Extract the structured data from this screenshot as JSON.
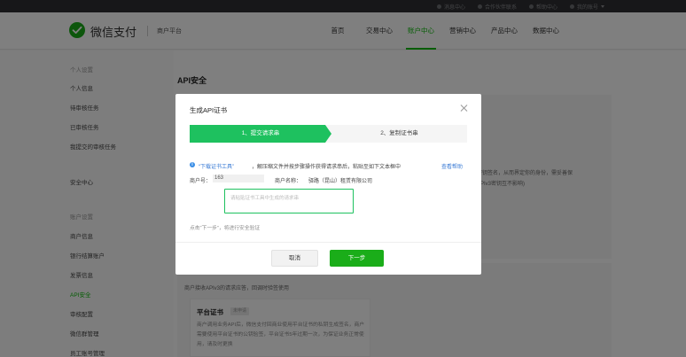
{
  "topbar": {
    "links": [
      {
        "label": "消息中心",
        "icon": "bell-icon"
      },
      {
        "label": "合作伙伴联系",
        "icon": "partner-icon"
      },
      {
        "label": "帮助中心",
        "icon": "help-icon"
      },
      {
        "label": "我的账号",
        "icon": "user-icon"
      }
    ]
  },
  "header": {
    "brand": "微信支付",
    "subbrand": "商户平台",
    "nav": [
      "首页",
      "交易中心",
      "账户中心",
      "营销中心",
      "产品中心",
      "数据中心"
    ],
    "active_nav": "账户中心",
    "accent": "#09bb07"
  },
  "sidebar": {
    "group1": "个人设置",
    "personal": [
      "个人信息",
      "待审核任务",
      "已审核任务",
      "我提交的审核任务"
    ],
    "security": "安全中心",
    "group2": "账户设置",
    "account": [
      "商户信息",
      "银行结算账户",
      "发票信息",
      "API安全",
      "审核配置",
      "微信群管理",
      "员工账号管理"
    ],
    "active_item": "API安全"
  },
  "main": {
    "page_title": "API安全",
    "right_text_1": "密钥签名，从而界定你的身份，需妥善保",
    "right_text_2": "APIv3密钥互不影响)",
    "section_desc": "商户接收APIv3的请求应答，回调时验签使用",
    "cert_card": {
      "title": "平台证书",
      "tag": "未申请",
      "desc": "商户调用业务API后，微信支付回商业使用平台证书的私钥生成签名，商户需要使用平台证书的公钥验签，平台证书5年过期一次，为保证业务正常使用，请及时更换"
    }
  },
  "modal": {
    "title": "生成API证书",
    "steps": [
      "1、提交请求串",
      "2、复制证书串"
    ],
    "info_link": "“下载证书工具”",
    "info_text": "，解压缩文件并按步骤操作获得请求串后，粘贴至如下文本框中",
    "help_link": "查看帮助",
    "merchant_id_label": "商户号：",
    "merchant_id_value": "163",
    "merchant_name_label": "商户名称：",
    "merchant_name_value": "驿路（昆山）租赁有限公司",
    "input_placeholder": "请粘贴证书工具中生成的请求串",
    "input_value": "",
    "hint": "点击“下一步”，将进行安全验证",
    "cancel_label": "取消",
    "next_label": "下一步",
    "primary_color": "#1aad19",
    "step_active_color": "#1ec15f"
  }
}
